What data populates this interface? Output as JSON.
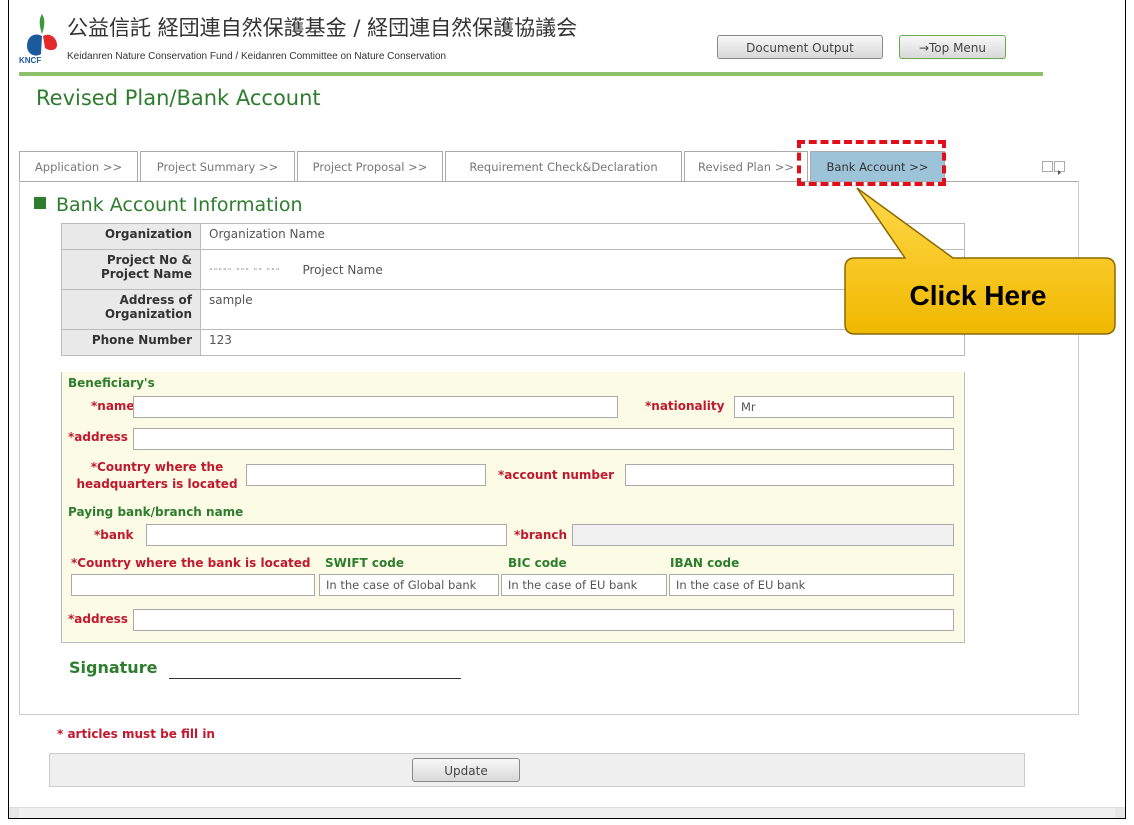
{
  "header": {
    "logo_text": "KNCF",
    "title_jp": "公益信託 経団連自然保護基金 / 経団連自然保護協議会",
    "title_en": "Keidanren Nature Conservation Fund / Keidanren Committee on Nature Conservation",
    "document_output_label": "Document Output",
    "top_menu_label": "→Top Menu"
  },
  "page_title": "Revised Plan/Bank Account",
  "tabs": [
    {
      "label": "Application >>"
    },
    {
      "label": "Project Summary >>"
    },
    {
      "label": "Project Proposal >>"
    },
    {
      "label": "Requirement Check&Declaration"
    },
    {
      "label": "Revised Plan >>"
    },
    {
      "label": "Bank Account >>",
      "active": true
    }
  ],
  "section_title": "Bank Account Information",
  "info": {
    "organization_label": "Organization",
    "organization_value": "Organization Name",
    "project_label_1": "Project No &",
    "project_label_2": "Project Name",
    "project_no_value": "\"\"\"\"\" \"\"\" \"\" \"\"\"",
    "project_name_value": "Project Name",
    "address_label_1": "Address of",
    "address_label_2": "Organization",
    "address_value": "sample",
    "phone_label": "Phone Number",
    "phone_value": "123"
  },
  "form": {
    "beneficiary_heading": "Beneficiary's",
    "name_label": "*name",
    "name_value": "",
    "nationality_label": "*nationality",
    "nationality_value": "Mr",
    "address_label": "*address",
    "address_value": "",
    "hq_country_label_1": "*Country where the",
    "hq_country_label_2": "headquarters is located",
    "hq_country_value": "",
    "account_number_label": "*account number",
    "account_number_value": "",
    "paying_bank_heading": "Paying bank/branch name",
    "bank_label": "*bank",
    "bank_value": "",
    "branch_label": "*branch",
    "branch_value": "",
    "bank_country_label": "*Country where the bank is located",
    "bank_country_value": "",
    "swift_label": "SWIFT code",
    "swift_placeholder": "In the case of Global bank",
    "bic_label": "BIC code",
    "bic_placeholder": "In the case of EU bank",
    "iban_label": "IBAN code",
    "iban_placeholder": "In the case of EU bank",
    "bank_address_label": "*address",
    "bank_address_value": ""
  },
  "signature_label": "Signature",
  "required_note": "* articles must be fill in",
  "update_label": "Update",
  "callout_text": "Click Here",
  "colors": {
    "accent_green": "#2e7d2e",
    "required_red": "#c0182e",
    "active_tab": "#9cc3d8",
    "callout_fill": "#f5c21a",
    "highlight_red": "#e0101a"
  }
}
